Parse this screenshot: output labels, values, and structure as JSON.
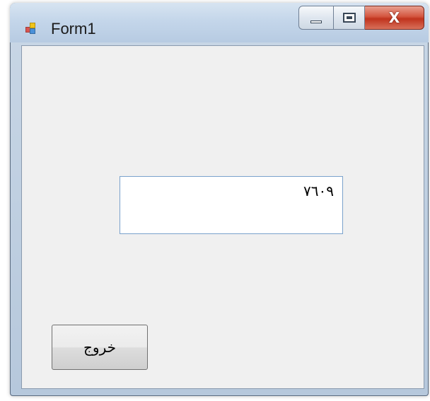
{
  "window": {
    "title": "Form1",
    "icon": "winforms-app-icon",
    "accent_colors": {
      "close_button": "#c0331d",
      "textbox_border": "#7aa2cc"
    }
  },
  "caption_buttons": {
    "minimize_icon": "minimize-icon",
    "maximize_icon": "maximize-icon",
    "close_glyph": "X"
  },
  "form": {
    "textbox_value": "٧٦٠٩",
    "exit_button_label": "خروج"
  }
}
